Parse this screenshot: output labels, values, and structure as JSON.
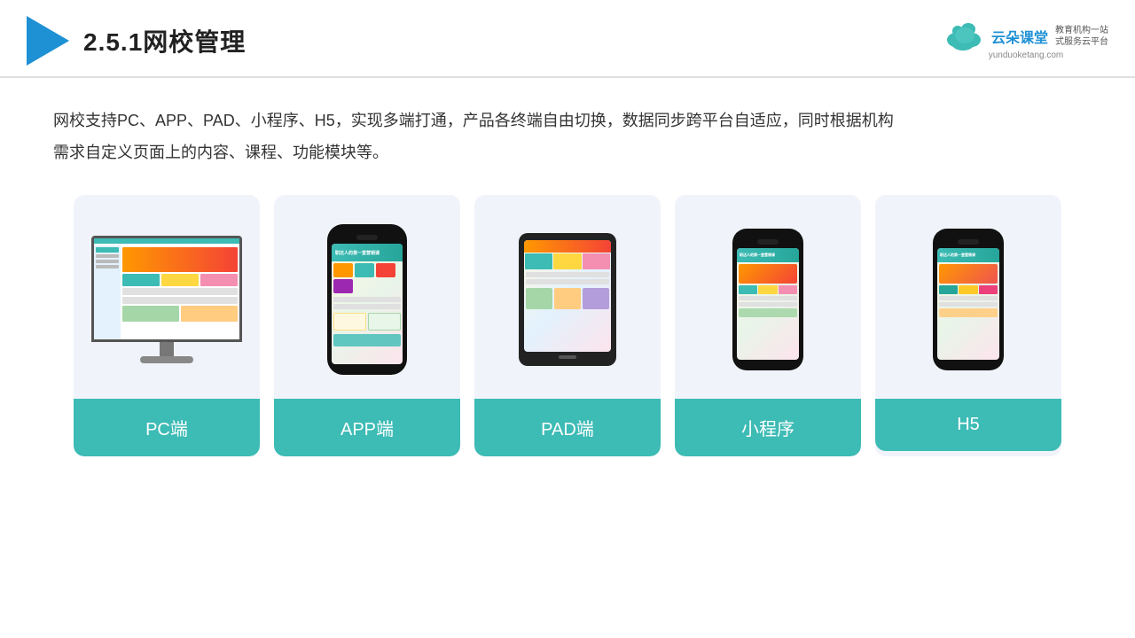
{
  "header": {
    "title": "2.5.1网校管理",
    "logo_name": "云朵课堂",
    "logo_url": "yunduoketang.com",
    "logo_tagline": "教育机构一站\n式服务云平台"
  },
  "description": {
    "text": "网校支持PC、APP、PAD、小程序、H5，实现多端打通，产品各终端自由切换，数据同步跨平台自适应，同时根据机构需求自定义页面上的内容、课程、功能模块等。"
  },
  "cards": [
    {
      "id": "pc",
      "label": "PC端",
      "type": "monitor"
    },
    {
      "id": "app",
      "label": "APP端",
      "type": "phone-tall"
    },
    {
      "id": "pad",
      "label": "PAD端",
      "type": "tablet"
    },
    {
      "id": "miniprogram",
      "label": "小程序",
      "type": "phone"
    },
    {
      "id": "h5",
      "label": "H5",
      "type": "phone"
    }
  ],
  "accent_color": "#3dbbb5"
}
